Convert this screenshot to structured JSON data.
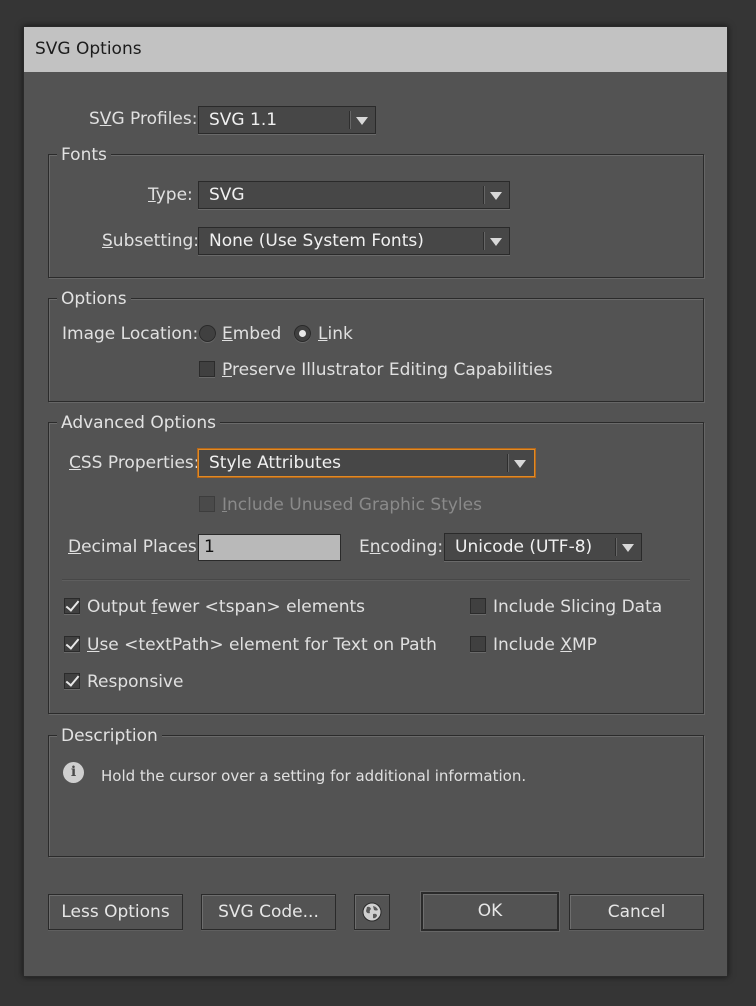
{
  "dialog": {
    "title": "SVG Options"
  },
  "svg_profiles": {
    "label_pre": "S",
    "label_ul": "V",
    "label_post": "G Profiles:",
    "value": "SVG 1.1"
  },
  "fonts": {
    "title": "Fonts",
    "type": {
      "label_ul": "T",
      "label_post": "ype:",
      "value": "SVG"
    },
    "subsetting": {
      "label_ul": "S",
      "label_post": "ubsetting:",
      "value": "None (Use System Fonts)"
    }
  },
  "options": {
    "title": "Options",
    "image_location_label": "Image Location:",
    "embed": {
      "label_ul": "E",
      "label_post": "mbed",
      "selected": false
    },
    "link": {
      "label_ul": "L",
      "label_post": "ink",
      "selected": true
    },
    "preserve": {
      "label_ul": "P",
      "label_post": "reserve Illustrator Editing Capabilities",
      "checked": false
    }
  },
  "advanced": {
    "title": "Advanced Options",
    "css_properties": {
      "label_ul": "C",
      "label_post": "SS Properties:",
      "value": "Style Attributes"
    },
    "include_unused": {
      "label_ul": "I",
      "label_post": "nclude Unused Graphic Styles",
      "checked": false,
      "disabled": true
    },
    "decimal_places": {
      "label_ul": "D",
      "label_post": "ecimal Places:",
      "value": "1"
    },
    "encoding": {
      "label_pre": "E",
      "label_ul": "n",
      "label_post": "coding:",
      "value": "Unicode (UTF-8)"
    },
    "output_fewer": {
      "label_pre": "Output ",
      "label_ul": "f",
      "label_post": "ewer <tspan> elements",
      "checked": true
    },
    "use_textpath": {
      "label_ul": "U",
      "label_post": "se <textPath> element for Text on Path",
      "checked": true
    },
    "responsive": {
      "label": "Responsive",
      "checked": true
    },
    "include_slicing": {
      "label_pre": "Include Slicin",
      "label_ul": "g",
      "label_post": " Data",
      "checked": false
    },
    "include_xmp": {
      "label_pre": "Include ",
      "label_ul": "X",
      "label_post": "MP",
      "checked": false
    }
  },
  "description": {
    "title": "Description",
    "text": "Hold the cursor over a setting for additional information.",
    "icon": "info-icon"
  },
  "buttons": {
    "less_options": "Less Options",
    "svg_code": "SVG Code...",
    "web_icon": "globe-icon",
    "ok": "OK",
    "cancel": "Cancel"
  },
  "colors": {
    "dialog_bg": "#535353",
    "title_bg": "#c2c2c2",
    "focus_accent": "#e08a26",
    "input_bg": "#b9b9b9"
  }
}
